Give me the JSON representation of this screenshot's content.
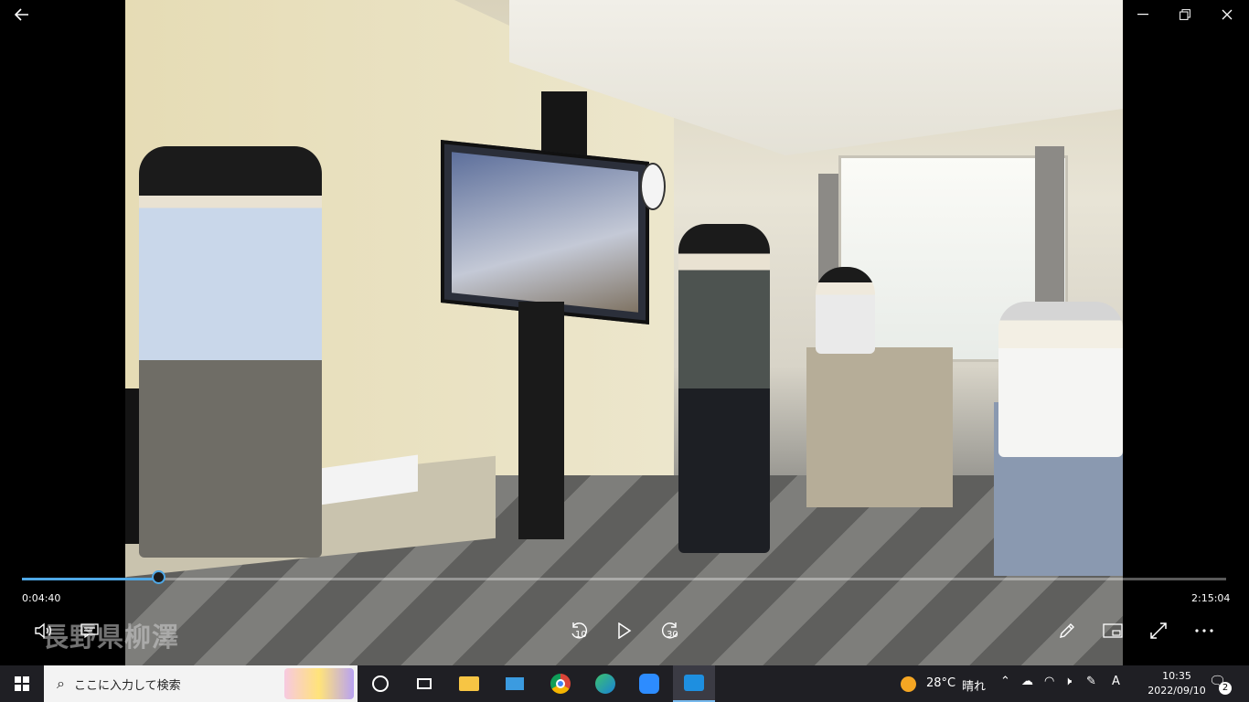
{
  "player": {
    "watermark": "長野県柳澤",
    "seek": {
      "current_time": "0:04:40",
      "total_time": "2:15:04",
      "progress_fraction": 0.1135
    },
    "icons": {
      "back": "back-arrow-icon",
      "minimize": "minimize-icon",
      "restore": "restore-icon",
      "close": "close-icon",
      "volume": "volume-icon",
      "subtitles": "subtitles-icon",
      "rewind": "rewind-10-icon",
      "play": "play-icon",
      "forward": "forward-30-icon",
      "edit": "pencil-icon",
      "miniview": "mini-view-icon",
      "fullscreen": "fullscreen-icon",
      "more": "more-icon"
    },
    "rewind_label": "10",
    "forward_label": "30",
    "accent_color": "#4fa8e6"
  },
  "taskbar": {
    "search_placeholder": "ここに入力して検索",
    "weather": {
      "temp": "28°C",
      "condition": "晴れ"
    },
    "time": "10:35",
    "date": "2022/09/10",
    "notification_count": "2",
    "apps": [
      "cortana",
      "task-view",
      "file-explorer",
      "this-pc",
      "chrome",
      "edge",
      "zoom",
      "films-tv"
    ]
  }
}
